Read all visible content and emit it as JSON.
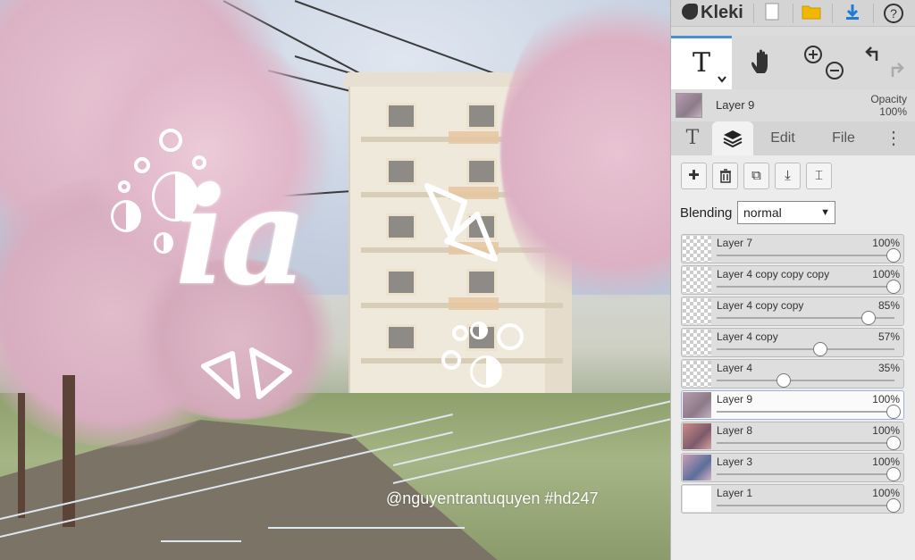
{
  "app": {
    "name": "Kleki"
  },
  "canvas": {
    "logo_text": "ia",
    "watermark": "@nguyentrantuquyen #hd247"
  },
  "toolbar": {
    "icons": [
      "new-image-icon",
      "open-folder-icon",
      "download-icon",
      "help-icon"
    ],
    "help_glyph": "?"
  },
  "tools": {
    "text_glyph": "T",
    "hand_icon": "hand-icon",
    "zoom_in_icon": "zoom-in-icon",
    "zoom_out_icon": "zoom-out-icon",
    "undo_icon": "undo-icon",
    "redo_icon": "redo-icon"
  },
  "current_layer": {
    "name": "Layer 9",
    "opacity_label": "Opacity",
    "opacity_value": "100%"
  },
  "tabs": [
    {
      "label": "T",
      "icon": "text-tab-icon"
    },
    {
      "label": "",
      "icon": "layers-icon",
      "active": true
    },
    {
      "label": "Edit"
    },
    {
      "label": "File"
    },
    {
      "label": "⋮",
      "icon": "more-icon"
    }
  ],
  "layer_buttons": [
    {
      "name": "add-layer-button",
      "glyph": "✚"
    },
    {
      "name": "delete-layer-button",
      "glyph": "🗑"
    },
    {
      "name": "duplicate-layer-button",
      "glyph": "⧉"
    },
    {
      "name": "merge-down-button",
      "glyph": "⤓"
    },
    {
      "name": "rename-layer-button",
      "glyph": "⌶"
    }
  ],
  "blending": {
    "label": "Blending",
    "value": "normal"
  },
  "layers": [
    {
      "name": "Layer 7",
      "opacity": "100%",
      "level": 1.0,
      "thumb": "checker"
    },
    {
      "name": "Layer 4 copy copy copy",
      "opacity": "100%",
      "level": 1.0,
      "thumb": "checker"
    },
    {
      "name": "Layer 4 copy copy",
      "opacity": "85%",
      "level": 0.85,
      "thumb": "checker"
    },
    {
      "name": "Layer 4 copy",
      "opacity": "57%",
      "level": 0.57,
      "thumb": "checker"
    },
    {
      "name": "Layer 4",
      "opacity": "35%",
      "level": 0.35,
      "thumb": "checker"
    },
    {
      "name": "Layer 9",
      "opacity": "100%",
      "level": 1.0,
      "thumb": "photo",
      "selected": true
    },
    {
      "name": "Layer 8",
      "opacity": "100%",
      "level": 1.0,
      "thumb": "photo-warm"
    },
    {
      "name": "Layer 3",
      "opacity": "100%",
      "level": 1.0,
      "thumb": "photo-blue"
    },
    {
      "name": "Layer 1",
      "opacity": "100%",
      "level": 1.0,
      "thumb": "white"
    }
  ],
  "colors": {
    "accent": "#4a90d9",
    "download": "#1e7bd6",
    "folder": "#f2b800"
  }
}
